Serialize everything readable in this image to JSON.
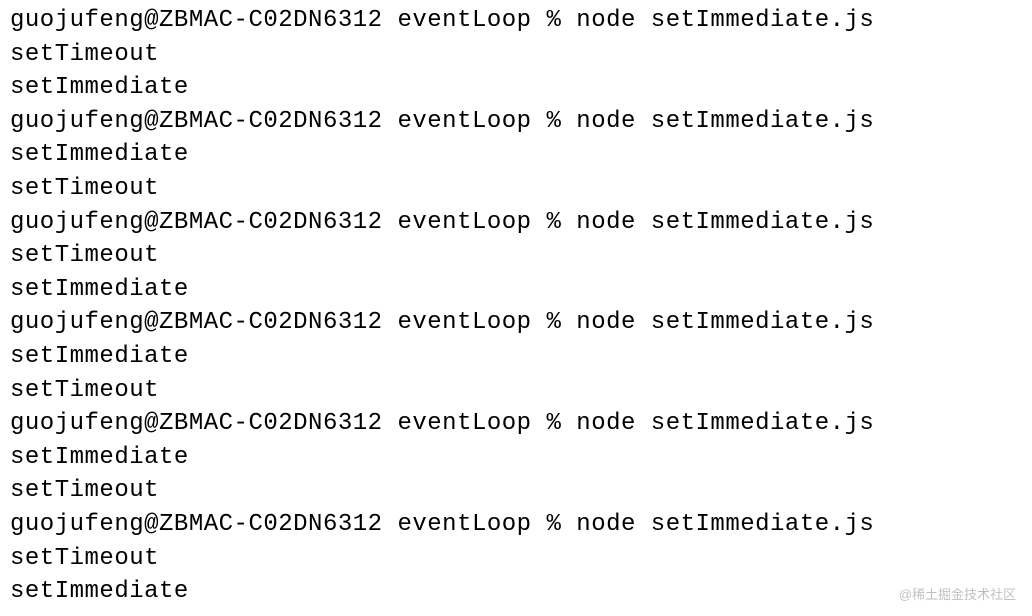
{
  "terminal": {
    "lines": [
      "guojufeng@ZBMAC-C02DN6312 eventLoop % node setImmediate.js",
      "setTimeout",
      "setImmediate",
      "guojufeng@ZBMAC-C02DN6312 eventLoop % node setImmediate.js",
      "setImmediate",
      "setTimeout",
      "guojufeng@ZBMAC-C02DN6312 eventLoop % node setImmediate.js",
      "setTimeout",
      "setImmediate",
      "guojufeng@ZBMAC-C02DN6312 eventLoop % node setImmediate.js",
      "setImmediate",
      "setTimeout",
      "guojufeng@ZBMAC-C02DN6312 eventLoop % node setImmediate.js",
      "setImmediate",
      "setTimeout",
      "guojufeng@ZBMAC-C02DN6312 eventLoop % node setImmediate.js",
      "setTimeout",
      "setImmediate"
    ]
  },
  "watermark": "@稀土掘金技术社区"
}
